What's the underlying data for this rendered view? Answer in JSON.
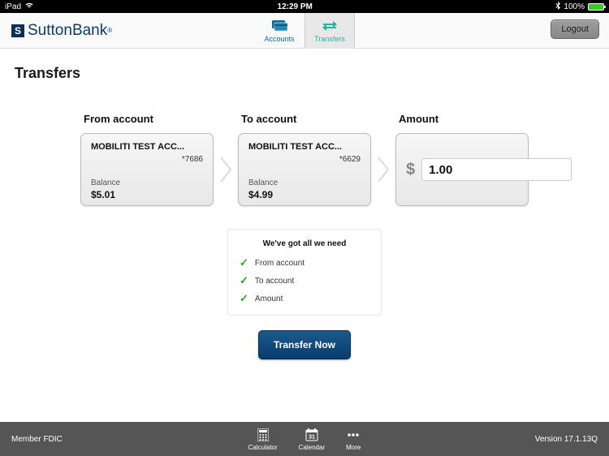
{
  "status": {
    "device": "iPad",
    "time": "12:29 PM",
    "battery": "100%"
  },
  "header": {
    "logo_s": "S",
    "logo_sutton": "Sutton",
    "logo_bank": "Bank",
    "logo_tm": "®",
    "tab_accounts": "Accounts",
    "tab_transfers": "Transfers",
    "logout": "Logout"
  },
  "page": {
    "title": "Transfers",
    "from_label": "From account",
    "to_label": "To account",
    "amount_label": "Amount",
    "balance_label": "Balance",
    "dollar_sign": "$"
  },
  "from_account": {
    "name": "MOBILITI TEST ACC...",
    "masked": "*7686",
    "balance": "$5.01"
  },
  "to_account": {
    "name": "MOBILITI TEST ACC...",
    "masked": "*6629",
    "balance": "$4.99"
  },
  "amount": {
    "value": "1.00"
  },
  "checklist": {
    "title": "We've got all we need",
    "items": [
      "From account",
      "To account",
      "Amount"
    ]
  },
  "action": {
    "transfer": "Transfer Now"
  },
  "footer": {
    "member": "Member FDIC",
    "calc": "Calculator",
    "cal": "Calendar",
    "cal_day": "31",
    "more": "More",
    "version": "Version 17.1.13Q"
  }
}
